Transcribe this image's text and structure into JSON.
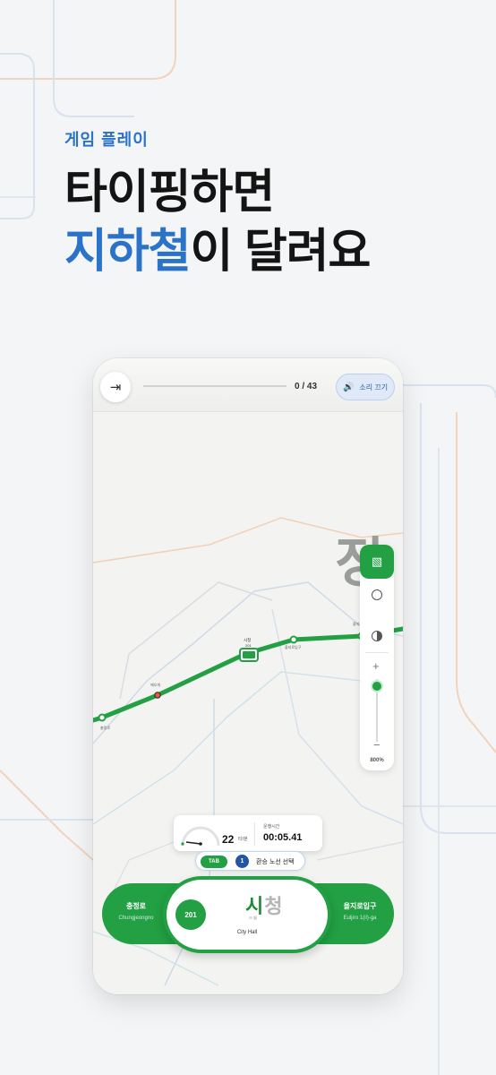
{
  "promo": {
    "eyebrow": "게임 플레이",
    "headline_line1": "타이핑하면",
    "headline_line2_accent": "지하철",
    "headline_line2_rest": "이 달려요"
  },
  "topbar": {
    "exit_icon": "exit-icon",
    "progress": "0 / 43",
    "progress_fraction": 0,
    "sound_label": "소리 끄기",
    "sound_icon": "speaker-icon"
  },
  "map": {
    "big_char": "정",
    "line_color": "#22a043",
    "stations": [
      "충정로",
      "시청\n201",
      "을지로입구",
      "을지로"
    ]
  },
  "side_panel": {
    "top_icon": "map-texture-icon",
    "circle_icon": "circle-icon",
    "contrast_icon": "contrast-icon",
    "zoom_in": "+",
    "zoom_out": "−",
    "zoom_level": "800%"
  },
  "stats": {
    "speed": "22",
    "speed_unit": "타/분",
    "time_label": "운행시간",
    "time": "00:05.41"
  },
  "transfer": {
    "tab_label": "TAB",
    "line_number": "1",
    "label": "환승 노선 선택"
  },
  "stations": {
    "prev_name": "충정로",
    "prev_roman": "Chungjeongno",
    "next_name": "을지로입구",
    "next_roman": "Euljiro 1(il)-ga",
    "current_code": "201",
    "current_typed": "시",
    "current_rest": "청",
    "current_hanja": "市 廳",
    "current_en": "City Hall"
  },
  "colors": {
    "accent_blue": "#2a73c8",
    "line2_green": "#22a043",
    "line1_blue": "#2255a6"
  }
}
